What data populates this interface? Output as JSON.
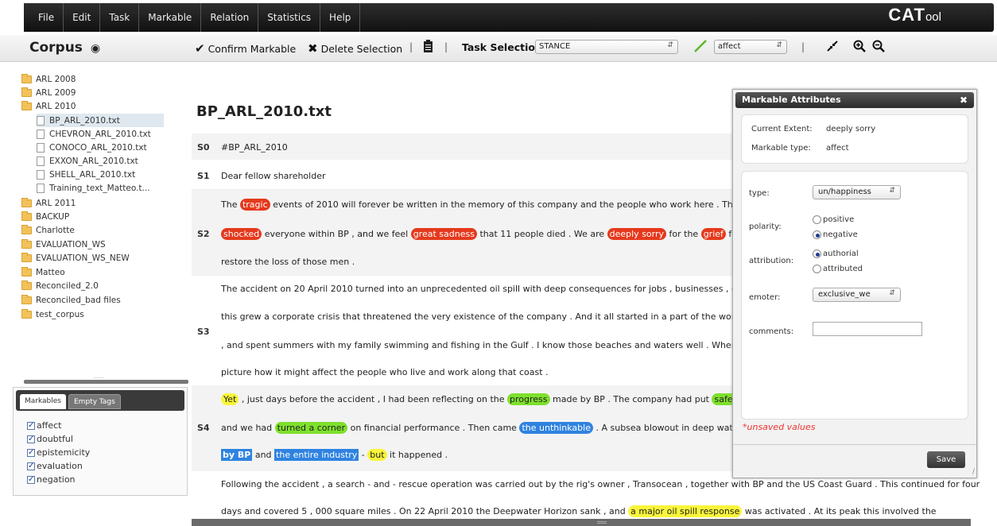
{
  "menubar": {
    "items": [
      "File",
      "Edit",
      "Task",
      "Markable",
      "Relation",
      "Statistics",
      "Help"
    ],
    "logo_big": "CAT",
    "logo_small": "ool"
  },
  "toolbar": {
    "corpus_label": "Corpus",
    "confirm_label": "Confirm Markable",
    "delete_label": "Delete Selection",
    "task_selection_label": "Task Selection",
    "task_value": "STANCE",
    "tag_value": "affect"
  },
  "sidebar": {
    "tree": [
      {
        "label": "ARL 2008",
        "type": "folder"
      },
      {
        "label": "ARL 2009",
        "type": "folder"
      },
      {
        "label": "ARL 2010",
        "type": "folder-open"
      },
      {
        "label": "BP_ARL_2010.txt",
        "type": "file"
      },
      {
        "label": "CHEVRON_ARL_2010.txt",
        "type": "file"
      },
      {
        "label": "CONOCO_ARL_2010.txt",
        "type": "file"
      },
      {
        "label": "EXXON_ARL_2010.txt",
        "type": "file"
      },
      {
        "label": "SHELL_ARL_2010.txt",
        "type": "file"
      },
      {
        "label": "Training_text_Matteo.t...",
        "type": "file"
      },
      {
        "label": "ARL 2011",
        "type": "folder"
      },
      {
        "label": "BACKUP",
        "type": "folder"
      },
      {
        "label": "Charlotte",
        "type": "folder"
      },
      {
        "label": "EVALUATION_WS",
        "type": "folder"
      },
      {
        "label": "EVALUATION_WS_NEW",
        "type": "folder"
      },
      {
        "label": "Matteo",
        "type": "folder"
      },
      {
        "label": "Reconciled_2.0",
        "type": "folder"
      },
      {
        "label": "Reconciled_bad files",
        "type": "folder"
      },
      {
        "label": "test_corpus",
        "type": "folder"
      }
    ],
    "splitter_dots": ".....",
    "tabs": [
      "Markables",
      "Empty Tags"
    ],
    "checkboxes": [
      "affect",
      "doubtful",
      "epistemicity",
      "evaluation",
      "negation"
    ]
  },
  "document": {
    "title": "BP_ARL_2010.txt",
    "s0": {
      "id": "S0",
      "text": "#BP_ARL_2010"
    },
    "s1": {
      "id": "S1",
      "text": "Dear fellow shareholder"
    },
    "s2": {
      "id": "S2",
      "l1a": "The ",
      "l1_tragic": "tragic",
      "l1b": " events of 2010 will forever be written in the memory of this company and the people who work here . The",
      "l2_shocked": "shocked",
      "l2a": " everyone within BP , and we feel ",
      "l2_sadness": "great sadness",
      "l2b": " that 11 people died . We are ",
      "l2_sorry": "deeply sorry",
      "l2c": " for the ",
      "l2_grief": "grief",
      "l2d": " fel",
      "l3": "restore the loss of those men ."
    },
    "s3": {
      "id": "S3",
      "l1": "The accident on 20 April 2010 turned into an unprecedented oil spill with deep consequences for jobs , businesses , c",
      "l2": "this grew a corporate crisis that threatened the very existence of the company . And it all started in a part of the world",
      "l3": ", and spent summers with my family swimming and fishing in the Gulf . I know those beaches and waters well . Wher",
      "l4": "picture how it might affect the people who live and work along that coast ."
    },
    "s4": {
      "id": "S4",
      "l1_yet": "Yet",
      "l1a": " , just days before the accident , I had been reflecting on the ",
      "l1_progress": "progress",
      "l1b": " made by BP . The company had put ",
      "l1_safe": "safe a",
      "l2a": "and we had ",
      "l2_corner": "turned a corner",
      "l2b": " on financial performance . Then came ",
      "l2_unthinkable": "the unthinkable",
      "l2c": " . A subsea blowout in deep wat",
      "l3_bybp": "by BP",
      "l3a": " and ",
      "l3_industry": "the entire industry",
      "l3b": " - ",
      "l3_but": "but",
      "l3c": " it happened ."
    },
    "s5": {
      "l1": "Following the accident , a search - and - rescue operation was carried out by the rig's owner , Transocean , together with BP and the US Coast Guard . This continued for four",
      "l2a": "days and covered 5 , 000 square miles . On 22 April 2010 the Deepwater Horizon sank , and ",
      "l2_response": "a major oil spill response",
      "l2b": " was activated . At its peak this involved the"
    }
  },
  "dialog": {
    "title": "Markable Attributes",
    "current_extent_label": "Current Extent:",
    "current_extent_value": "deeply sorry",
    "markable_type_label": "Markable type:",
    "markable_type_value": "affect",
    "type_label": "type:",
    "type_value": "un/happiness",
    "polarity_label": "polarity:",
    "polarity_options": [
      "positive",
      "negative"
    ],
    "polarity_selected": "negative",
    "attribution_label": "attribution:",
    "attribution_options": [
      "authorial",
      "attributed"
    ],
    "attribution_selected": "authorial",
    "emoter_label": "emoter:",
    "emoter_value": "exclusive_we",
    "comments_label": "comments:",
    "unsaved_text": "*unsaved values",
    "save_label": "Save"
  },
  "colors": {
    "affect_red": "#e5391d",
    "evaluation_green": "#7ee02c",
    "doubtful_blue": "#2f83e0",
    "epistemicity_yellow": "#f9f53a"
  }
}
